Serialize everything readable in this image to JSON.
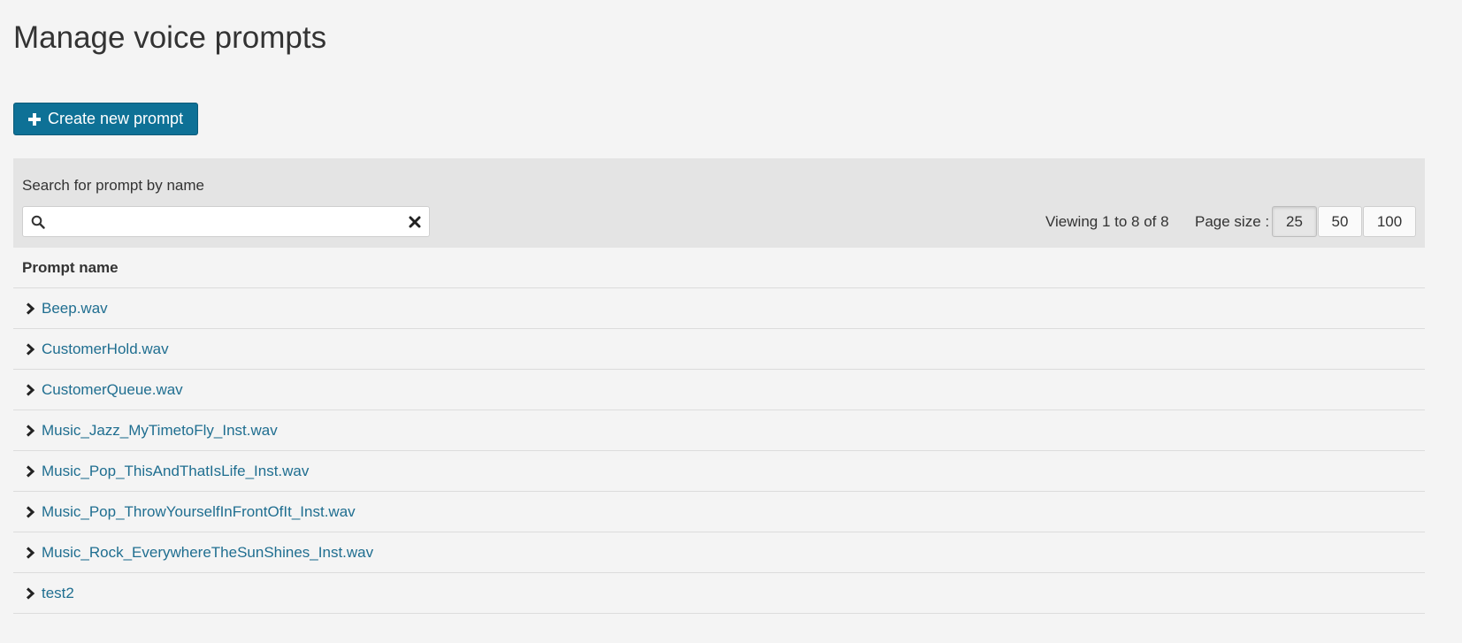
{
  "page": {
    "title": "Manage voice prompts"
  },
  "actions": {
    "create_label": "Create new prompt",
    "create_icon": "plus-icon"
  },
  "search": {
    "label": "Search for prompt by name",
    "value": "",
    "placeholder": "",
    "icon": "search-icon",
    "clear_icon": "close-icon"
  },
  "pagination": {
    "viewing_text": "Viewing 1 to 8 of 8",
    "page_size_label": "Page size :",
    "sizes": [
      "25",
      "50",
      "100"
    ],
    "selected_size": "25"
  },
  "table": {
    "column_header": "Prompt name",
    "rows": [
      "Beep.wav",
      "CustomerHold.wav",
      "CustomerQueue.wav",
      "Music_Jazz_MyTimetoFly_Inst.wav",
      "Music_Pop_ThisAndThatIsLife_Inst.wav",
      "Music_Pop_ThrowYourselfInFrontOfIt_Inst.wav",
      "Music_Rock_EverywhereTheSunShines_Inst.wav",
      "test2"
    ],
    "row_icon": "chevron-right-icon"
  },
  "colors": {
    "background": "#f4f4f4",
    "primary_button": "#0e7196",
    "link": "#1f6e90",
    "toolbar_bg": "#e4e4e4"
  }
}
